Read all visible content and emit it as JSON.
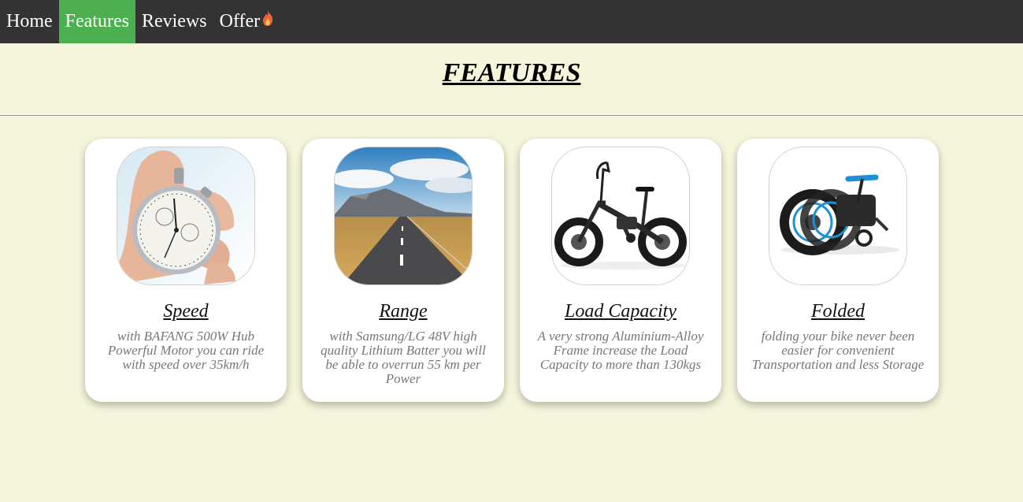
{
  "nav": {
    "items": [
      {
        "label": "Home",
        "active": false
      },
      {
        "label": "Features",
        "active": true
      },
      {
        "label": "Reviews",
        "active": false
      },
      {
        "label": "Offer",
        "active": false,
        "icon": "flame-icon"
      }
    ]
  },
  "page": {
    "title": "FEATURES"
  },
  "features": [
    {
      "title": "Speed",
      "description": "with BAFANG 500W Hub Powerful Motor you can ride with speed over 35km/h",
      "image": "stopwatch-image"
    },
    {
      "title": "Range",
      "description": "with Samsung/LG 48V high quality Lithium Batter you will be able to overrun 55 km per Power",
      "image": "road-landscape-image"
    },
    {
      "title": "Load Capacity",
      "description": "A very strong Aluminium-Alloy Frame increase the Load Capacity to more than 130kgs",
      "image": "ebike-image"
    },
    {
      "title": "Folded",
      "description": "folding your bike never been easier for convenient Transportation and less Storage",
      "image": "folded-ebike-image"
    }
  ],
  "colors": {
    "background": "#f5f5dc",
    "navbar": "#333333",
    "nav_active": "#4caf50",
    "card": "#ffffff",
    "description_text": "#777777"
  }
}
